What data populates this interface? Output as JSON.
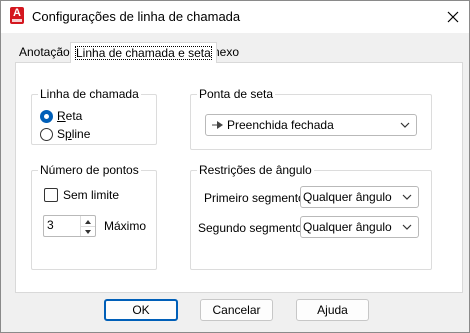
{
  "window": {
    "title": "Configurações de linha de chamada",
    "app_icon": "autocad-icon"
  },
  "tabs": [
    {
      "label": "Anotação",
      "active": false
    },
    {
      "label": "Linha de chamada e seta",
      "active": true
    },
    {
      "label": "Anexo",
      "active": false
    }
  ],
  "leader_line": {
    "legend": "Linha de chamada",
    "options": [
      {
        "label": "Reta",
        "checked": true
      },
      {
        "label": "Spline",
        "checked": false
      }
    ]
  },
  "arrowhead": {
    "legend": "Ponta de seta",
    "selected": "Preenchida fechada",
    "icon": "arrowhead-closed-filled-icon"
  },
  "num_points": {
    "legend": "Número de pontos",
    "no_limit_label": "Sem limite",
    "no_limit_checked": false,
    "value": "3",
    "max_label": "Máximo"
  },
  "angle_constraints": {
    "legend": "Restrições de ângulo",
    "first_label": "Primeiro segmento:",
    "first_value": "Qualquer ângulo",
    "second_label": "Segundo segmento:",
    "second_value": "Qualquer ângulo"
  },
  "buttons": {
    "ok": "OK",
    "cancel": "Cancelar",
    "help": "Ajuda"
  }
}
